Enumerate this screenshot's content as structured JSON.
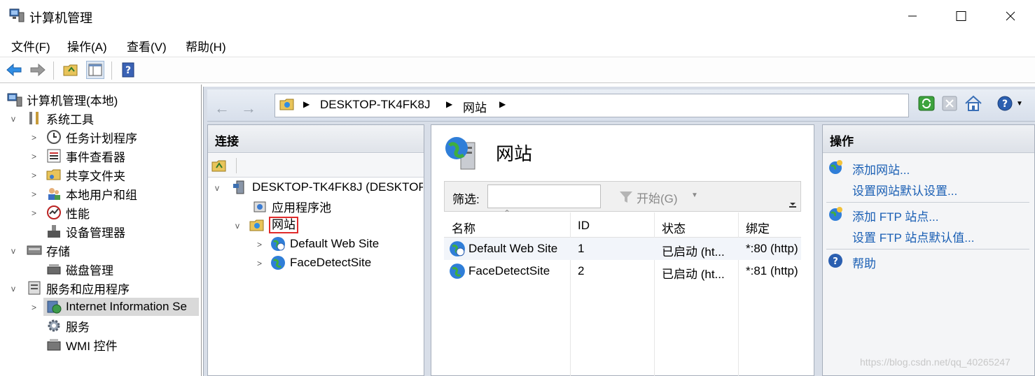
{
  "window": {
    "title": "计算机管理"
  },
  "menu": {
    "items": [
      "文件(F)",
      "操作(A)",
      "查看(V)",
      "帮助(H)"
    ]
  },
  "left_tree": {
    "root": "计算机管理(本地)",
    "items": [
      {
        "label": "系统工具"
      },
      {
        "label": "任务计划程序"
      },
      {
        "label": "事件查看器"
      },
      {
        "label": "共享文件夹"
      },
      {
        "label": "本地用户和组"
      },
      {
        "label": "性能"
      },
      {
        "label": "设备管理器"
      },
      {
        "label": "存储"
      },
      {
        "label": "磁盘管理"
      },
      {
        "label": "服务和应用程序"
      },
      {
        "label": "Internet Information Se"
      },
      {
        "label": "服务"
      },
      {
        "label": "WMI 控件"
      }
    ]
  },
  "address": {
    "crumbs": [
      "DESKTOP-TK4FK8J",
      "网站"
    ]
  },
  "connections": {
    "title": "连接",
    "server": "DESKTOP-TK4FK8J (DESKTOP",
    "app_pools": "应用程序池",
    "sites": "网站",
    "site_nodes": [
      "Default Web Site",
      "FaceDetectSite"
    ]
  },
  "center": {
    "title": "网站",
    "filter_label": "筛选:",
    "go_label": "开始(G)",
    "columns": [
      "名称",
      "ID",
      "状态",
      "绑定"
    ],
    "rows": [
      {
        "name": "Default Web Site",
        "id": "1",
        "status": "已启动 (ht...",
        "binding": "*:80 (http)"
      },
      {
        "name": "FaceDetectSite",
        "id": "2",
        "status": "已启动 (ht...",
        "binding": "*:81 (http)"
      }
    ]
  },
  "actions": {
    "title": "操作",
    "add_site": "添加网站...",
    "site_defaults": "设置网站默认设置...",
    "add_ftp": "添加 FTP 站点...",
    "ftp_defaults": "设置 FTP 站点默认值...",
    "help": "帮助"
  },
  "watermark": "https://blog.csdn.net/qq_40265247",
  "colors": {
    "link": "#1a5fb4",
    "highlight_border": "#e02b2b",
    "panel_bg": "#d8dee8"
  }
}
